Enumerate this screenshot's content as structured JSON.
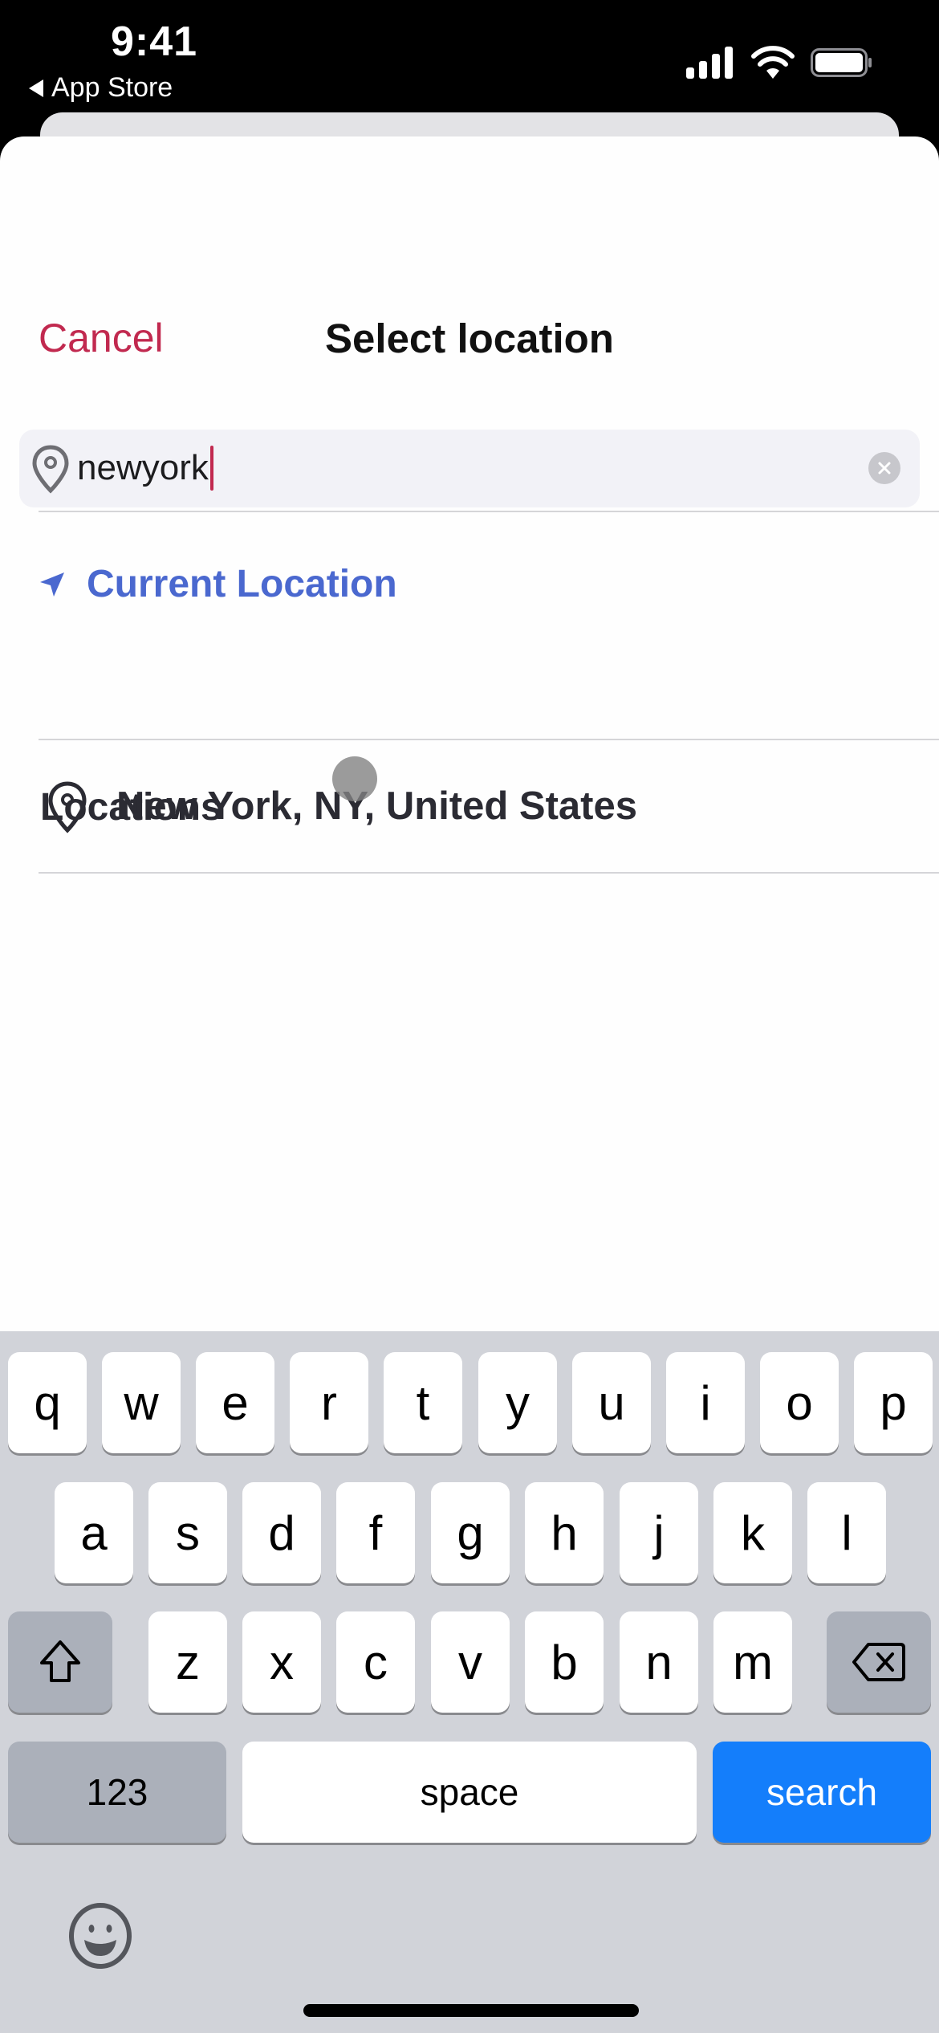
{
  "status_bar": {
    "time": "9:41",
    "back_app": "App Store",
    "icons": [
      "cellular-signal-icon",
      "wifi-icon",
      "battery-icon"
    ]
  },
  "header": {
    "cancel_label": "Cancel",
    "title": "Select location"
  },
  "search": {
    "value": "newyork",
    "icon": "map-pin-icon",
    "clear_icon": "clear-icon"
  },
  "current_location": {
    "label": "Current Location",
    "icon": "location-arrow-icon"
  },
  "locations": {
    "heading": "Locations",
    "items": [
      {
        "label": "New York, NY, United States",
        "icon": "map-pin-icon"
      }
    ]
  },
  "keyboard": {
    "row1": [
      "q",
      "w",
      "e",
      "r",
      "t",
      "y",
      "u",
      "i",
      "o",
      "p"
    ],
    "row2": [
      "a",
      "s",
      "d",
      "f",
      "g",
      "h",
      "j",
      "k",
      "l"
    ],
    "row3": [
      "z",
      "x",
      "c",
      "v",
      "b",
      "n",
      "m"
    ],
    "numbers_label": "123",
    "space_label": "space",
    "return_label": "search",
    "shift_icon": "shift-icon",
    "delete_icon": "backspace-icon",
    "emoji_icon": "emoji-icon"
  },
  "colors": {
    "cancel": "#c1294f",
    "link": "#4a68cf",
    "keyboard_return": "#147efb"
  }
}
